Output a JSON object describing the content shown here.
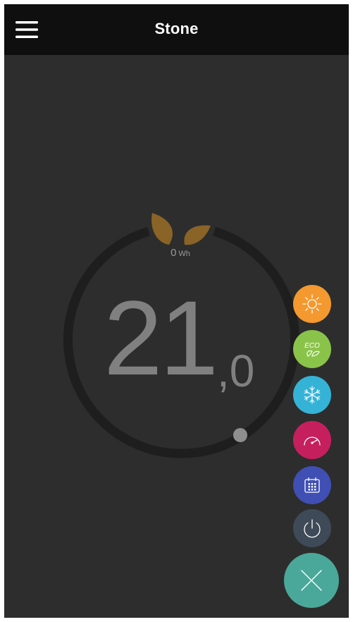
{
  "header": {
    "title": "Stone"
  },
  "energy": {
    "value": "0",
    "unit": "Wh"
  },
  "temperature": {
    "integer": "21",
    "decimal": ",0"
  },
  "modes": [
    {
      "name": "comfort",
      "icon": "sun-icon",
      "color": "#f3992f"
    },
    {
      "name": "eco",
      "icon": "eco-icon",
      "label": "ECO",
      "color": "#8ac34a"
    },
    {
      "name": "frost-protection",
      "icon": "snowflake-icon",
      "color": "#35b3d6"
    },
    {
      "name": "boost",
      "icon": "speedometer-icon",
      "color": "#c61f5e"
    },
    {
      "name": "schedule",
      "icon": "calendar-icon",
      "color": "#3f4fb3"
    },
    {
      "name": "off",
      "icon": "power-icon",
      "color": "#3e4a57"
    }
  ],
  "close_fab": {
    "icon": "close-icon",
    "color": "#4aa89a"
  },
  "colors": {
    "background": "#2d2d2d",
    "appbar": "#0f0f0f",
    "ring": "#1e1e1e",
    "leaf": "#8a6327",
    "knob": "#8e8e8e"
  }
}
